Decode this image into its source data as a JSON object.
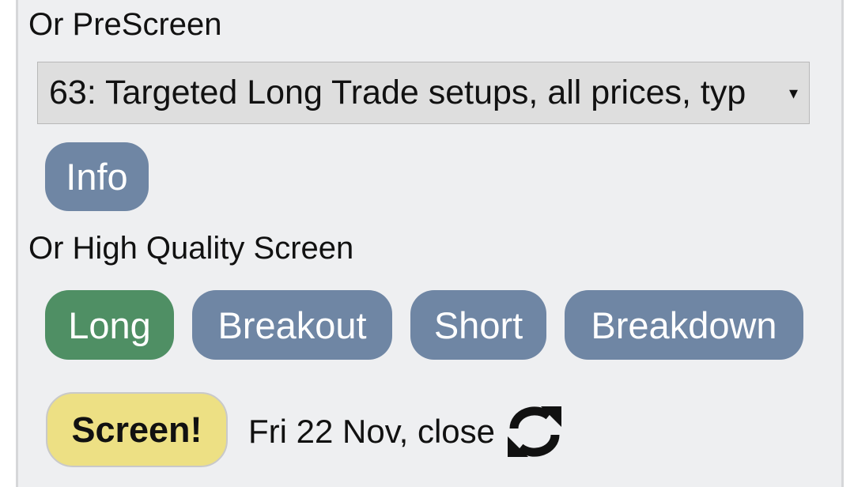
{
  "prescreen": {
    "heading": "Or PreScreen",
    "selected_option": "63: Targeted Long Trade setups, all prices, typ",
    "caret": "▾",
    "info_label": "Info"
  },
  "hq_screen": {
    "heading": "Or High Quality Screen",
    "buttons": [
      {
        "label": "Long",
        "color": "#4f8f64",
        "active": true
      },
      {
        "label": "Breakout",
        "color": "#6f86a4",
        "active": false
      },
      {
        "label": "Short",
        "color": "#6f86a4",
        "active": false
      },
      {
        "label": "Breakdown",
        "color": "#6f86a4",
        "active": false
      }
    ]
  },
  "action": {
    "screen_label": "Screen!",
    "date_label": "Fri 22 Nov, close",
    "refresh_icon": "refresh-icon"
  }
}
